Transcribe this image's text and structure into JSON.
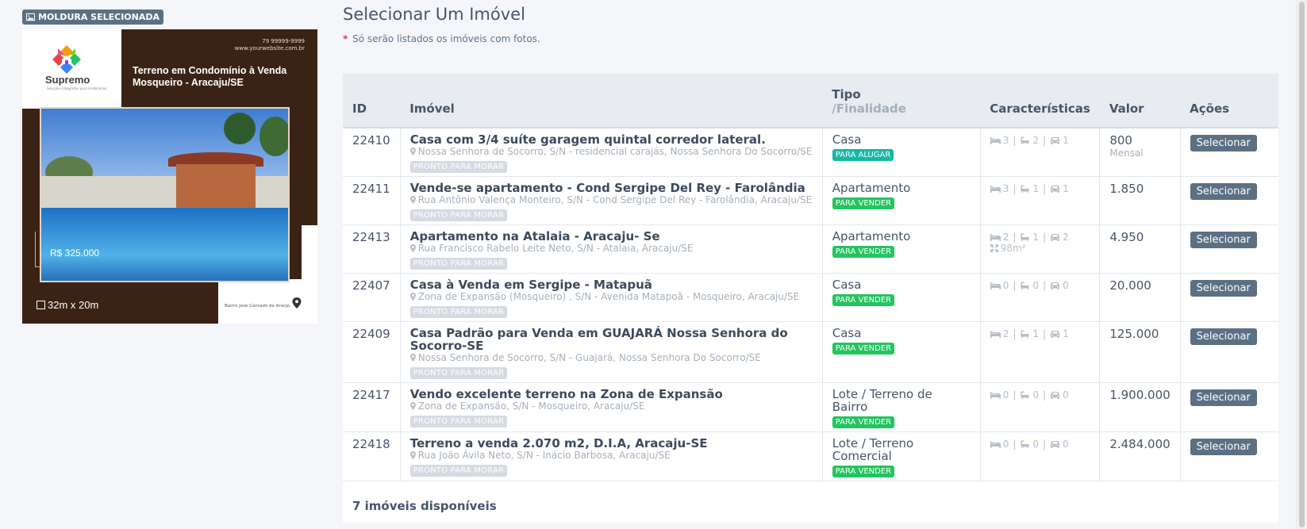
{
  "frame": {
    "badge": "MOLDURA SELECIONADA",
    "logo_name": "Supremo",
    "logo_tag": "Soluções Integradas para Imobiliárias",
    "phone": "79 99999-9999",
    "website": "www.yourwebsite.com.br",
    "title_line1": "Terreno em Condomínio à Venda",
    "title_line2": "Mosqueiro - Aracaju/SE",
    "price": "R$ 325.000",
    "dims": "32m x 20m",
    "bairro": "Bairro Jose Conrado de Araújo"
  },
  "page": {
    "title": "Selecionar Um Imóvel",
    "note_star": "*",
    "note": "Só serão listados os imóveis com fotos."
  },
  "table": {
    "headers": {
      "id": "ID",
      "imovel": "Imóvel",
      "tipo": "Tipo",
      "finalidade": "/Finalidade",
      "caracteristicas": "Características",
      "valor": "Valor",
      "acoes": "Ações"
    },
    "rows": [
      {
        "id": "22410",
        "title": "Casa com 3/4 suíte garagem quintal corredor lateral.",
        "address": "Nossa Senhora de Socorro, S/N - residencial carajás, Nossa Senhora Do Socorro/SE",
        "status": "PRONTO PARA MORAR",
        "tipo": "Casa",
        "finalidade": "PARA ALUGAR",
        "quartos": "3",
        "banheiros": "2",
        "vagas": "1",
        "area": "",
        "valor": "800",
        "valor_sub": "Mensal",
        "action": "Selecionar"
      },
      {
        "id": "22411",
        "title": "Vende-se apartamento - Cond Sergipe Del Rey - Farolândia",
        "address": "Rua Antônio Valença Monteiro, S/N - Cond Sergipe Del Rey - Farolândia, Aracaju/SE",
        "status": "PRONTO PARA MORAR",
        "tipo": "Apartamento",
        "finalidade": "PARA VENDER",
        "quartos": "3",
        "banheiros": "1",
        "vagas": "1",
        "area": "",
        "valor": "1.850",
        "valor_sub": "",
        "action": "Selecionar"
      },
      {
        "id": "22413",
        "title": "Apartamento na Atalaia - Aracaju- Se",
        "address": "Rua Francisco Rabelo Leite Neto, S/N - Atalaia, Aracaju/SE",
        "status": "PRONTO PARA MORAR",
        "tipo": "Apartamento",
        "finalidade": "PARA VENDER",
        "quartos": "2",
        "banheiros": "1",
        "vagas": "2",
        "area": "98m²",
        "valor": "4.950",
        "valor_sub": "",
        "action": "Selecionar"
      },
      {
        "id": "22407",
        "title": "Casa à Venda em Sergipe - Matapuã",
        "address": "Zona de Expansão (Mosqueiro) , S/N - Avenida Matapoã - Mosqueiro, Aracaju/SE",
        "status": "PRONTO PARA MORAR",
        "tipo": "Casa",
        "finalidade": "PARA VENDER",
        "quartos": "0",
        "banheiros": "0",
        "vagas": "0",
        "area": "",
        "valor": "20.000",
        "valor_sub": "",
        "action": "Selecionar"
      },
      {
        "id": "22409",
        "title": "Casa Padrão para Venda em GUAJARÁ Nossa Senhora do Socorro-SE",
        "address": "Nossa Senhora de Socorro, S/N - Guajará, Nossa Senhora Do Socorro/SE",
        "status": "PRONTO PARA MORAR",
        "tipo": "Casa",
        "finalidade": "PARA VENDER",
        "quartos": "2",
        "banheiros": "1",
        "vagas": "1",
        "area": "",
        "valor": "125.000",
        "valor_sub": "",
        "action": "Selecionar"
      },
      {
        "id": "22417",
        "title": "Vendo excelente terreno na Zona de Expansão",
        "address": "Zona de Expansão, S/N - Mosqueiro, Aracaju/SE",
        "status": "PRONTO PARA MORAR",
        "tipo": "Lote / Terreno de Bairro",
        "finalidade": "PARA VENDER",
        "quartos": "0",
        "banheiros": "0",
        "vagas": "0",
        "area": "",
        "valor": "1.900.000",
        "valor_sub": "",
        "action": "Selecionar"
      },
      {
        "id": "22418",
        "title": "Terreno a venda 2.070 m2, D.I.A, Aracaju-SE",
        "address": "Rua João Ávila Neto, S/N - Inácio Barbosa, Aracaju/SE",
        "status": "PRONTO PARA MORAR",
        "tipo": "Lote / Terreno Comercial",
        "finalidade": "PARA VENDER",
        "quartos": "0",
        "banheiros": "0",
        "vagas": "0",
        "area": "",
        "valor": "2.484.000",
        "valor_sub": "",
        "action": "Selecionar"
      }
    ],
    "footer": "7 imóveis disponíveis"
  },
  "colors": {
    "badge_bg": "#5b7083",
    "para_alugar": "#14b8a6",
    "para_vender": "#22c55e",
    "poster_brown": "#3a2314"
  }
}
